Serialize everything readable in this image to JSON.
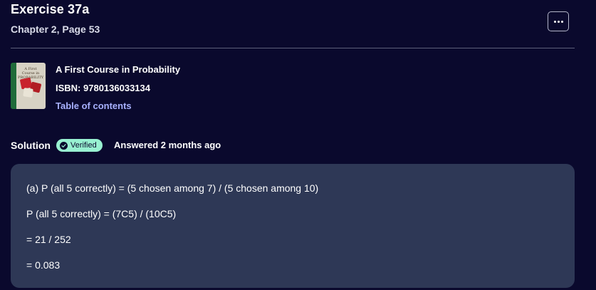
{
  "header": {
    "title": "Exercise 37a",
    "subtitle": "Chapter 2, Page 53",
    "more_icon": "more-horizontal-icon"
  },
  "book": {
    "title": "A First Course in Probability",
    "isbn": "ISBN: 9780136033134",
    "toc_link": "Table of contents",
    "cover": {
      "title": "A First Course in PROBABILITY"
    }
  },
  "solution": {
    "label": "Solution",
    "badge": "Verified",
    "badge_icon": "verified-check-icon",
    "answered": "Answered 2 months ago",
    "lines": [
      "(a) P (all 5 correctly) = (5 chosen among 7) / (5 chosen among 10)",
      "P (all 5 correctly) = (7C5) / (10C5)",
      "= 21 / 252",
      "= 0.083"
    ]
  },
  "colors": {
    "background": "#0a092d",
    "card": "#2e3856",
    "badge": "#98f1d1",
    "link": "#a8b1ff"
  }
}
